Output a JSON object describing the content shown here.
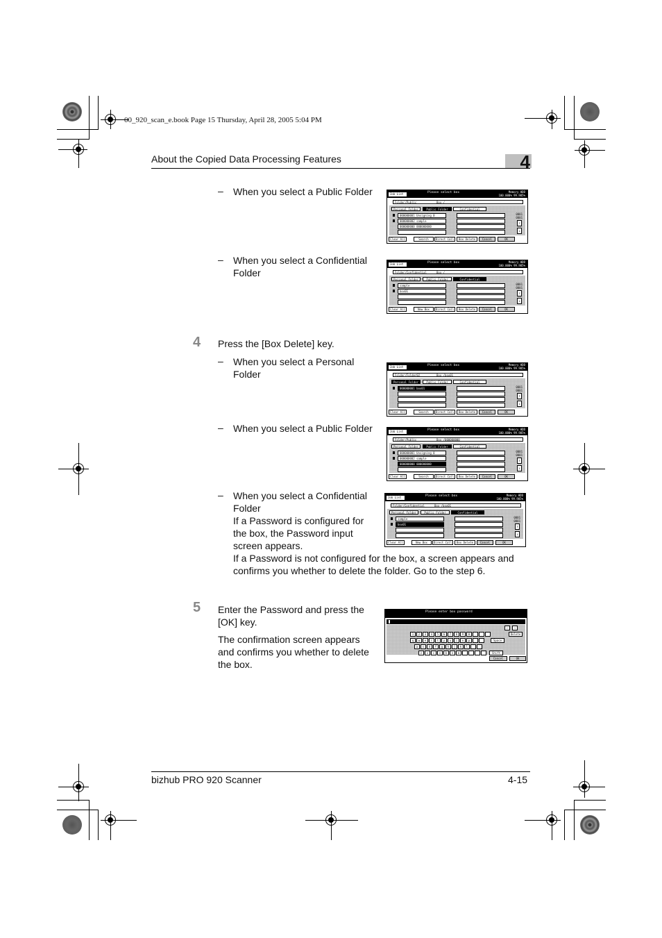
{
  "print_marks": {
    "book_info": "00_920_scan_e.book  Page 15  Thursday, April 28, 2005  5:04 PM"
  },
  "header": {
    "title": "About the Copied Data Processing Features",
    "chapter_number": "4"
  },
  "content": {
    "items": [
      {
        "type": "sub",
        "dash": "–",
        "text": "When you select a Public Folder",
        "screen": 0
      },
      {
        "type": "sub",
        "dash": "–",
        "text": "When you select a Confidential Folder",
        "screen": 1
      }
    ],
    "step4": {
      "number": "4",
      "text": "Press the [Box Delete] key.",
      "subs": [
        {
          "dash": "–",
          "text": "When you select a Personal Folder"
        },
        {
          "dash": "–",
          "text": "When you select a Public Folder"
        },
        {
          "dash": "–",
          "text": "When you select a Confidential Folder",
          "extra1": "If a Password is configured for the box, the Password input screen appears.",
          "extra2": "If a Password is not configured for the box, a screen appears and confirms you whether to delete the folder. Go to the step 6."
        }
      ]
    },
    "step5": {
      "number": "5",
      "text": "Enter the Password and press the [OK] key.",
      "note": "The confirmation screen appears and confirms you whether to delete the box."
    }
  },
  "screens": [
    {
      "job_list": "Job List",
      "prompt": "Please select box",
      "memory_label": "Memory  HDD",
      "memory_value": "100.000%  99.905%",
      "folder": "Folder/Public",
      "box": "Box  /",
      "tabs": [
        "Personal Folder",
        "Public Folder",
        "Confidential"
      ],
      "active_tab": 1,
      "rows": [
        {
          "text": "000000001 Unsigning 0",
          "lock": true,
          "sel": false
        },
        {
          "text": "000000002 sample",
          "lock": true,
          "sel": false
        },
        {
          "text": "000000000 000000000",
          "lock": false,
          "sel": false
        },
        {
          "text": "",
          "lock": false,
          "sel": false
        }
      ],
      "counts": [
        "0001",
        "0001"
      ],
      "buttons": [
        "Clear All",
        "Search",
        "Direct Call",
        "Box Delete",
        "Cancel",
        "OK"
      ]
    },
    {
      "job_list": "Job List",
      "prompt": "Please select box",
      "memory_label": "Memory  HDD",
      "memory_value": "100.000%  99.905%",
      "folder": "Folder/Confidential",
      "box": "Box  /",
      "tabs": [
        "Personal Folder",
        "Public Folder",
        "Confidential"
      ],
      "active_tab": 2,
      "rows": [
        {
          "text": "sample",
          "lock": true,
          "sel": false
        },
        {
          "text": "box01",
          "lock": true,
          "sel": false
        },
        {
          "text": "",
          "lock": false,
          "sel": false
        },
        {
          "text": "",
          "lock": false,
          "sel": false
        }
      ],
      "counts": [
        "0001",
        "0001"
      ],
      "buttons": [
        "Clear All",
        "New Box",
        "Direct Call",
        "Box Delete",
        "Cancel",
        "OK"
      ]
    },
    {
      "job_list": "Job List",
      "prompt": "Please select box",
      "memory_label": "Memory  HDD",
      "memory_value": "100.000%  99.905%",
      "folder": "Folder/Folder02",
      "box": "Box  /box01",
      "tabs": [
        "Personal Folder",
        "Public Folder",
        "Confidential"
      ],
      "active_tab": 0,
      "rows": [
        {
          "text": "000000001 box01",
          "lock": true,
          "sel": true
        },
        {
          "text": "",
          "lock": false,
          "sel": false
        },
        {
          "text": "",
          "lock": false,
          "sel": false
        },
        {
          "text": "",
          "lock": false,
          "sel": false
        }
      ],
      "counts": [
        "0001",
        "0001"
      ],
      "buttons": [
        "Clear All",
        "Search",
        "Direct Call",
        "Box Delete",
        "Cancel",
        "OK"
      ]
    },
    {
      "job_list": "Job List",
      "prompt": "Please select box",
      "memory_label": "Memory  HDD",
      "memory_value": "100.000%  99.905%",
      "folder": "Folder/Public",
      "box": "Box  /000000000",
      "tabs": [
        "Personal Folder",
        "Public Folder",
        "Confidential"
      ],
      "active_tab": 1,
      "rows": [
        {
          "text": "000000001 Unsigning 0",
          "lock": true,
          "sel": false
        },
        {
          "text": "000000002 sample",
          "lock": true,
          "sel": false
        },
        {
          "text": "000000000 000000000",
          "lock": false,
          "sel": true
        },
        {
          "text": "",
          "lock": false,
          "sel": false
        }
      ],
      "counts": [
        "0001",
        "0001"
      ],
      "buttons": [
        "Clear All",
        "Search",
        "Direct Call",
        "Box Delete",
        "Cancel",
        "OK"
      ]
    },
    {
      "job_list": "Job List",
      "prompt": "Please select box",
      "memory_label": "Memory  HDD",
      "memory_value": "100.000%  99.905%",
      "folder": "Folder/Confidential",
      "box": "Box  /box01",
      "tabs": [
        "Personal Folder",
        "Public Folder",
        "Confidential"
      ],
      "active_tab": 2,
      "rows": [
        {
          "text": "sample",
          "lock": true,
          "sel": false
        },
        {
          "text": "box01",
          "lock": true,
          "sel": true
        },
        {
          "text": "",
          "lock": false,
          "sel": false
        },
        {
          "text": "",
          "lock": false,
          "sel": false
        }
      ],
      "counts": [
        "0001",
        "0001"
      ],
      "buttons": [
        "Clear All",
        "New Box",
        "Direct Call",
        "Box Delete",
        "Cancel",
        "OK"
      ]
    }
  ],
  "password_screen": {
    "prompt": "Please enter box password",
    "row1": [
      "1",
      "2",
      "3",
      "4",
      "5",
      "6",
      "7",
      "8",
      "9",
      "0",
      "",
      "",
      ""
    ],
    "row2": [
      "q",
      "w",
      "e",
      "r",
      "t",
      "y",
      "u",
      "i",
      "o",
      "p",
      "",
      ""
    ],
    "row3": [
      "a",
      "s",
      "d",
      "f",
      "g",
      "h",
      "j",
      "k",
      "l",
      "",
      ""
    ],
    "row4": [
      "z",
      "x",
      "c",
      "v",
      "b",
      "n",
      "m",
      "",
      "",
      "",
      ""
    ],
    "left_arrow": "←",
    "right_arrow": "→",
    "delete": "Delete",
    "space": "Space",
    "shift": "Shift",
    "cancel": "Cancel",
    "ok": "OK"
  },
  "footer": {
    "product": "bizhub PRO 920 Scanner",
    "page": "4-15"
  }
}
